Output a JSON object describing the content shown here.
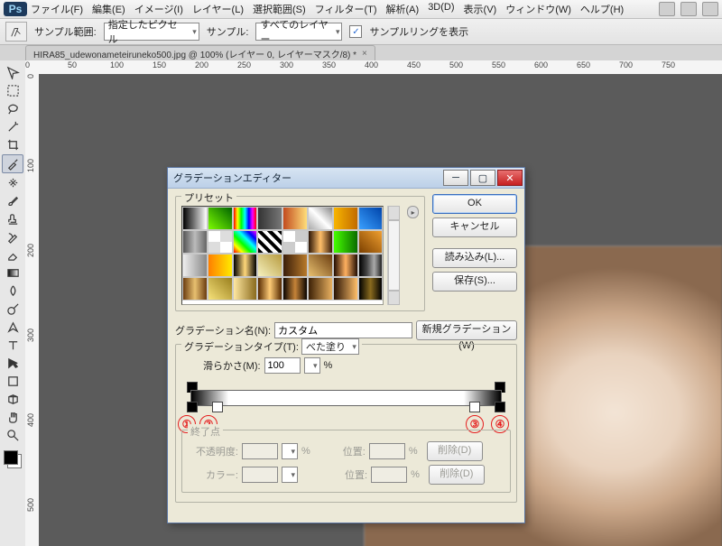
{
  "app": {
    "logo": "Ps"
  },
  "menu": {
    "items": [
      "ファイル(F)",
      "編集(E)",
      "イメージ(I)",
      "レイヤー(L)",
      "選択範囲(S)",
      "フィルター(T)",
      "解析(A)",
      "3D(D)",
      "表示(V)",
      "ウィンドウ(W)",
      "ヘルプ(H)"
    ]
  },
  "options": {
    "sample_label": "サンプル範囲:",
    "sample_value": "指定したピクセル",
    "sample2_label": "サンプル:",
    "sample2_value": "すべてのレイヤー",
    "ring_label": "サンプルリングを表示",
    "ring_checked": "✓"
  },
  "document": {
    "tab_title": "HIRA85_udewonameteiruneko500.jpg @ 100% (レイヤー 0, レイヤーマスク/8) *"
  },
  "ruler_h": [
    "0",
    "50",
    "100",
    "150",
    "200",
    "250",
    "300",
    "350",
    "400",
    "450",
    "500",
    "550",
    "600",
    "650",
    "700",
    "750"
  ],
  "ruler_v": [
    "0",
    "100",
    "200",
    "300",
    "400",
    "500"
  ],
  "dialog": {
    "title": "グラデーションエディター",
    "presets_label": "プリセット",
    "ok": "OK",
    "cancel": "キャンセル",
    "load": "読み込み(L)...",
    "save": "保存(S)...",
    "name_label": "グラデーション名(N):",
    "name_value": "カスタム",
    "new_btn": "新規グラデーション(W)",
    "type_label": "グラデーションタイプ(T):",
    "type_value": "べた塗り",
    "smooth_label": "滑らかさ(M):",
    "smooth_value": "100",
    "smooth_unit": "%",
    "stops_label": "終了点",
    "opacity_label": "不透明度:",
    "opacity_unit": "%",
    "pos_label": "位置:",
    "pos_unit": "%",
    "delete_btn": "削除(D)",
    "color_label": "カラー:",
    "ann": [
      "①",
      "②",
      "③",
      "④"
    ]
  },
  "preset_gradients": [
    "linear-gradient(90deg,#000,#fff)",
    "linear-gradient(45deg,#7cfc00,#006400)",
    "linear-gradient(90deg,#ff0000,#ffff00,#00ff00,#00ffff,#0000ff,#ff00ff,#ff0000)",
    "linear-gradient(90deg,#333,#777)",
    "linear-gradient(90deg,#c24b1e,#ffde7a)",
    "linear-gradient(45deg,#aaa,#fff,#888)",
    "linear-gradient(90deg,#f8b500,#c26b00)",
    "linear-gradient(45deg,#3aa0ff,#0044aa)",
    "linear-gradient(90deg,#555,#bbb,#666)",
    "repeating-conic-gradient(#ddd 0 25%,#fff 0 50%)",
    "linear-gradient(45deg,#ff0000,#ffff00,#00ff00,#00ffff,#0000ff,#ff00ff)",
    "repeating-linear-gradient(45deg,#000 0 4px,#fff 4px 8px)",
    "repeating-conic-gradient(#ccc 0 25%,#fff 0 50%)",
    "linear-gradient(90deg,#2a1405,#ffbf6a,#3a1d0a)",
    "linear-gradient(90deg,#46ff00,#0a6c00)",
    "linear-gradient(45deg,#7b3f00,#f0a030)",
    "linear-gradient(90deg,#eee,#888)",
    "linear-gradient(90deg,#ff7f00,#ffea00)",
    "linear-gradient(90deg,#000,#ffd77a,#000)",
    "linear-gradient(45deg,#f6f2c0,#b89b3f)",
    "linear-gradient(90deg,#3a1d0a,#b87a2a)",
    "linear-gradient(45deg,#e8c070,#6b3d10)",
    "linear-gradient(90deg,#220d02,#ffb060,#220d02)",
    "linear-gradient(90deg,#000,#444,#aaa,#222)",
    "linear-gradient(90deg,#6b3d10,#e8c070,#6b3d10)",
    "linear-gradient(45deg,#f6e27a,#9a7f1e)",
    "linear-gradient(90deg,#ffe7a0,#8a6b1e)",
    "linear-gradient(90deg,#552900,#ffcc77,#552900)",
    "linear-gradient(90deg,#0a0400,#c58338,#0a0400)",
    "linear-gradient(90deg,#3d2106,#e8b060)",
    "linear-gradient(90deg,#2a1405,#ffbf6a)",
    "linear-gradient(90deg,#000,#8a6b1e,#000)"
  ]
}
